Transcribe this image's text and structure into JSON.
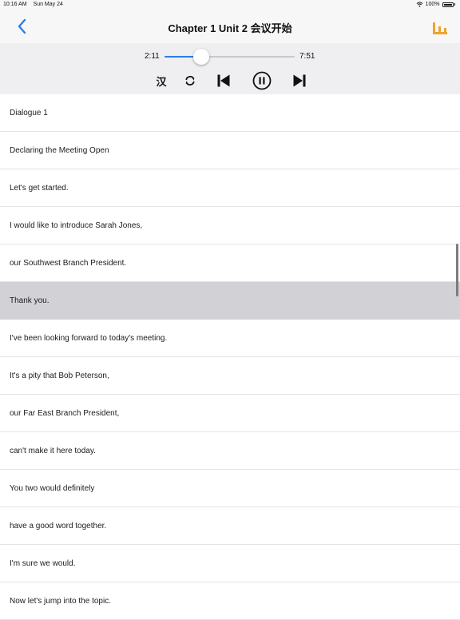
{
  "status_bar": {
    "time": "10:16 AM",
    "date": "Sun May 24",
    "battery": "100%"
  },
  "nav": {
    "title": "Chapter 1 Unit 2 会议开始"
  },
  "player": {
    "current_time": "2:11",
    "total_time": "7:51",
    "progress": 0.28,
    "han_label": "汉"
  },
  "colors": {
    "accent_blue": "#2b7de9",
    "accent_orange": "#f0a22e",
    "selected_row": "#d2d2d6"
  },
  "list": {
    "selected_index": 5,
    "items": [
      "Dialogue 1",
      "Declaring the Meeting Open",
      "Let's get started.",
      "I would like to introduce Sarah Jones,",
      "our Southwest Branch President.",
      "Thank you.",
      "I've been looking forward to today's meeting.",
      "It's a pity that Bob Peterson,",
      "our Far East Branch President,",
      "can't make it here today.",
      "You two would definitely",
      "have a good word together.",
      "I'm sure we would.",
      "Now let's jump into the topic."
    ]
  }
}
